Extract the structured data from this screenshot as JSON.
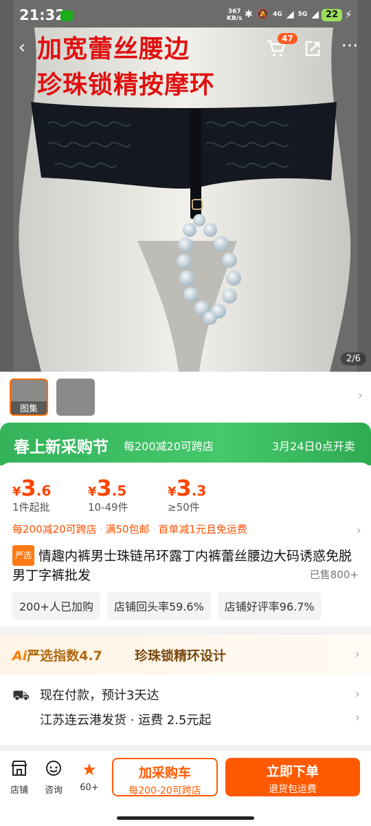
{
  "status_bar": {
    "time": "21:32",
    "net_speed_value": "367",
    "net_speed_unit": "KB/s",
    "signal_4g": "4G",
    "signal_5g": "5G",
    "battery": "22"
  },
  "nav": {
    "back_icon": "chevron-left-icon",
    "cart_badge": "47",
    "share_icon": "share-icon",
    "more_icon": "more-icon"
  },
  "hero": {
    "overlay_line1": "加宽蕾丝腰边",
    "overlay_line2": "珍珠锁精按摩环",
    "pager": "2/6"
  },
  "thumbnails": [
    {
      "caption": "图集",
      "selected": true
    },
    {
      "caption": "",
      "selected": false
    }
  ],
  "promo_banner": {
    "title": "春上新采购节",
    "offer": "每200减20可跨店",
    "date": "3月24日0点开卖"
  },
  "prices": [
    {
      "symbol": "¥",
      "int": "3",
      "dec": ".6",
      "note": "1件起批"
    },
    {
      "symbol": "¥",
      "int": "3",
      "dec": ".5",
      "note": "10-49件"
    },
    {
      "symbol": "¥",
      "int": "3",
      "dec": ".3",
      "note": "≥50件"
    }
  ],
  "deals": [
    "每200减20可跨店",
    "满50包邮",
    "首单减1元且免运费"
  ],
  "product": {
    "tag": "严选",
    "title": "情趣内裤男士珠链吊环露丁内裤蕾丝腰边大码诱惑免脱男丁字裤批发",
    "sold": "已售800+"
  },
  "chips": [
    "200+人已加购",
    "店铺回头率59.6%",
    "店铺好评率96.7%"
  ],
  "yanxuan": {
    "ai": "Ai",
    "label": "严选指数4.7",
    "feature": "珍珠锁精环设计"
  },
  "shipping": {
    "line1": "现在付款，预计3天达",
    "line2": "江苏连云港发货 · 运费 2.5元起"
  },
  "bottom_bar": {
    "store_label": "店铺",
    "chat_label": "咨询",
    "fav_label": "60+",
    "cart_button": {
      "label": "加采购车",
      "sub": "每200-20可跨店"
    },
    "buy_button": {
      "label": "立即下单",
      "sub": "退货包运费"
    }
  },
  "colors": {
    "accent": "#ff5a00",
    "promo_green": "#3cbc60",
    "price": "#ff4400"
  }
}
